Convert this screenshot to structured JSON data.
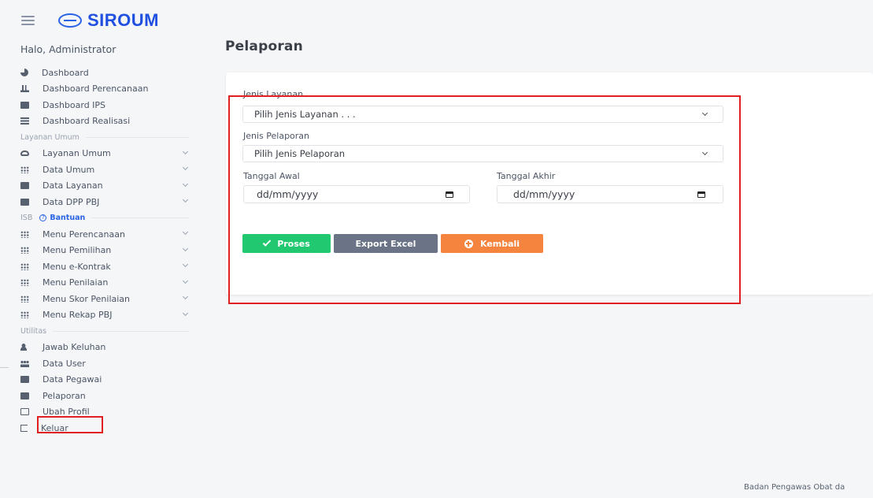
{
  "header": {
    "app_name": "SIROUM",
    "logo_icon": "siroum-logo-icon"
  },
  "sidebar": {
    "greeting": "Halo, Administrator",
    "items_top": [
      {
        "label": "Dashboard",
        "icon": "pie-chart-icon"
      },
      {
        "label": "Dashboard Perencanaan",
        "icon": "bar-chart-icon"
      },
      {
        "label": "Dashboard IPS",
        "icon": "box-icon"
      },
      {
        "label": "Dashboard Realisasi",
        "icon": "list-icon"
      }
    ],
    "section_layanan": "Layanan Umum",
    "items_layanan": [
      {
        "label": "Layanan Umum",
        "icon": "cloud-icon"
      },
      {
        "label": "Data Umum",
        "icon": "grid-icon"
      },
      {
        "label": "Data Layanan",
        "icon": "box-icon"
      },
      {
        "label": "Data DPP PBJ",
        "icon": "box-icon"
      }
    ],
    "section_isb": "ISB",
    "bantuan": "Bantuan",
    "items_isb": [
      {
        "label": "Menu Perencanaan",
        "icon": "grid-icon"
      },
      {
        "label": "Menu Pemilihan",
        "icon": "grid-icon"
      },
      {
        "label": "Menu e-Kontrak",
        "icon": "grid-icon"
      },
      {
        "label": "Menu Penilaian",
        "icon": "grid-icon"
      },
      {
        "label": "Menu Skor Penilaian",
        "icon": "grid-icon"
      },
      {
        "label": "Menu Rekap PBJ",
        "icon": "grid-icon"
      }
    ],
    "section_utilitas": "Utilitas",
    "items_utilitas": [
      {
        "label": "Jawab Keluhan",
        "icon": "user-icon"
      },
      {
        "label": "Data User",
        "icon": "users-icon"
      },
      {
        "label": "Data Pegawai",
        "icon": "id-card-icon"
      },
      {
        "label": "Pelaporan",
        "icon": "report-icon"
      },
      {
        "label": "Ubah Profil",
        "icon": "edit-icon"
      },
      {
        "label": "Keluar",
        "icon": "logout-icon"
      }
    ]
  },
  "main": {
    "title": "Pelaporan",
    "form": {
      "jenis_layanan_label": "Jenis Layanan",
      "jenis_layanan_value": "Pilih Jenis Layanan . . .",
      "jenis_pelaporan_label": "Jenis Pelaporan",
      "jenis_pelaporan_value": "Pilih Jenis Pelaporan",
      "tanggal_awal_label": "Tanggal Awal",
      "tanggal_awal_placeholder": "dd/mm/yyyy",
      "tanggal_akhir_label": "Tanggal Akhir",
      "tanggal_akhir_placeholder": "dd/mm/yyyy"
    },
    "buttons": {
      "proses": "Proses",
      "export": "Export Excel",
      "kembali": "Kembali"
    }
  },
  "footer": {
    "text": "Badan Pengawas Obat da"
  },
  "colors": {
    "brand": "#1f50e0",
    "proses": "#22c870",
    "export": "#6b7487",
    "kembali": "#f5843f",
    "highlight": "#e02020"
  }
}
